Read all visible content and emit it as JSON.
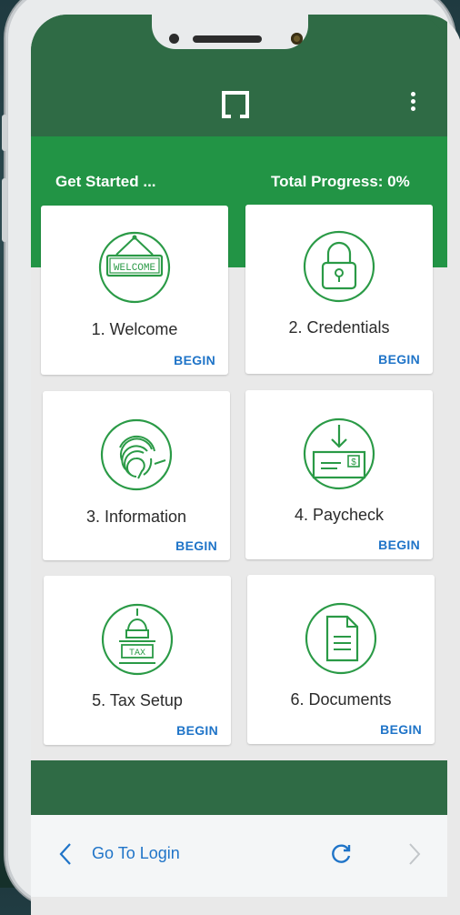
{
  "header": {
    "menu_icon": "kebab-menu-icon",
    "logo_icon": "app-logo-icon"
  },
  "progress": {
    "left_label": "Get Started ...",
    "right_label": "Total Progress: 0%",
    "value_percent": 0
  },
  "steps": [
    {
      "title": "1. Welcome",
      "action": "BEGIN",
      "icon": "welcome-sign-icon",
      "sign_text": "WELCOME"
    },
    {
      "title": "2. Credentials",
      "action": "BEGIN",
      "icon": "padlock-icon"
    },
    {
      "title": "3. Information",
      "action": "BEGIN",
      "icon": "fingerprint-icon"
    },
    {
      "title": "4. Paycheck",
      "action": "BEGIN",
      "icon": "paycheck-icon",
      "check_symbol": "$"
    },
    {
      "title": "5. Tax Setup",
      "action": "BEGIN",
      "icon": "capitol-tax-icon",
      "tax_text": "TAX"
    },
    {
      "title": "6. Documents",
      "action": "BEGIN",
      "icon": "document-icon"
    }
  ],
  "footer": {
    "back_label": "Go To Login",
    "back_icon": "chevron-left-icon",
    "refresh_icon": "refresh-icon",
    "forward_icon": "chevron-right-icon"
  },
  "colors": {
    "header": "#2f6b45",
    "band": "#229445",
    "icon_green": "#2a9a46",
    "link_blue": "#1f74c8"
  }
}
